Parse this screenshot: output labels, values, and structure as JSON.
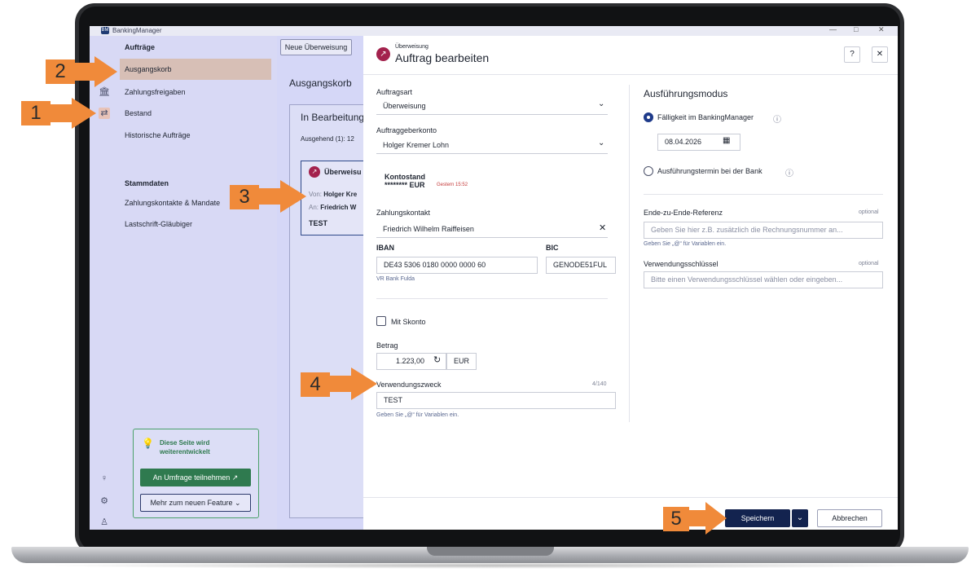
{
  "app": {
    "title": "BankingManager",
    "logo": "BM"
  },
  "window_controls": {
    "minimize": "—",
    "maximize": "□",
    "close": "✕"
  },
  "nav": {
    "heading": "Aufträge",
    "items": [
      {
        "label": "Ausgangskorb",
        "selected": true
      },
      {
        "label": "Zahlungsfreigaben",
        "selected": false
      },
      {
        "label": "Bestand",
        "selected": false
      },
      {
        "label": "Historische Aufträge",
        "selected": false
      }
    ],
    "section2_heading": "Stammdaten",
    "section2_items": [
      {
        "label": "Zahlungskontakte & Mandate"
      },
      {
        "label": "Lastschrift-Gläubiger"
      }
    ]
  },
  "feature_box": {
    "text": "Diese Seite wird weiterentwickelt",
    "survey_button": "An Umfrage teilnehmen",
    "more_button": "Mehr zum neuen Feature"
  },
  "mid": {
    "new_button": "Neue Überweisung",
    "title": "Ausgangskorb",
    "card_title": "In Bearbeitung",
    "outgoing": "Ausgehend (1): 12",
    "order": {
      "type": "Überweisu",
      "from_label": "Von:",
      "from": "Holger Kre",
      "to_label": "An:",
      "to": "Friedrich W",
      "purpose": "TEST"
    }
  },
  "dialog": {
    "subtitle": "Überweisung",
    "title": "Auftrag bearbeiten",
    "auftragsart_label": "Auftragsart",
    "auftragsart_value": "Überweisung",
    "auftraggeber_label": "Auftraggeberkonto",
    "auftraggeber_value": "Holger Kremer Lohn",
    "kontostand_label": "Kontostand",
    "kontostand_value": "******** EUR",
    "kontostand_time": "Gestern 15:52",
    "zahlungskontakt_label": "Zahlungskontakt",
    "zahlungskontakt_value": "Friedrich Wilhelm Raiffeisen",
    "iban_label": "IBAN",
    "iban_value": "DE43 5306 0180 0000 0000 60",
    "bic_label": "BIC",
    "bic_value": "GENODE51FUL",
    "bank_name": "VR Bank Fulda",
    "skonto_label": "Mit Skonto",
    "betrag_label": "Betrag",
    "betrag_value": "1.223,00",
    "currency": "EUR",
    "vzweck_label": "Verwendungszweck",
    "vzweck_count": "4/140",
    "vzweck_value": "TEST",
    "vzweck_hint": "Geben Sie „@“ für Variablen ein.",
    "modus_title": "Ausführungsmodus",
    "modus_option1": "Fälligkeit im BankingManager",
    "date_value": "08.04.2026",
    "modus_option2": "Ausführungstermin bei der Bank",
    "e2e_label": "Ende-zu-Ende-Referenz",
    "optional": "optional",
    "e2e_placeholder": "Geben Sie hier z.B. zusätzlich die Rechnungsnummer an...",
    "e2e_hint": "Geben Sie „@“ für Variablen ein.",
    "vschluessel_label": "Verwendungsschlüssel",
    "vschluessel_placeholder": "Bitte einen Verwendungsschlüssel wählen oder eingeben...",
    "save_button": "Speichern",
    "cancel_button": "Abbrechen"
  },
  "markers": [
    "1",
    "2",
    "3",
    "4",
    "5"
  ],
  "colors": {
    "accent": "#13234f",
    "marker": "#f08a3a",
    "selection": "#d7bfb6",
    "green": "#2f7a4f"
  }
}
